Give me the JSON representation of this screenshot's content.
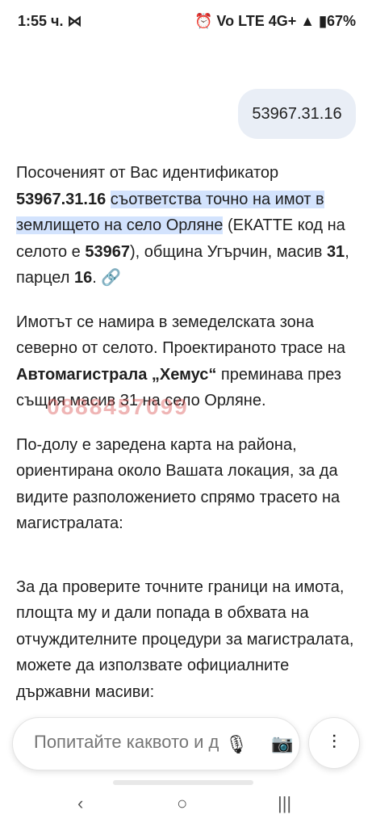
{
  "status": {
    "time": "1:55 ч. ⋈",
    "right": "⏰ Vo LTE 4G+ ▲ ▮67%"
  },
  "user_message": "53967.31.16",
  "p1": {
    "a": "Посоченият от Вас идентификатор ",
    "b": "53967.31.16",
    "c": "съответства точно на имот в землището на село Орляне",
    "d": " (ЕКАТТЕ код на селото е ",
    "e": "53967",
    "f": "), община Угърчин, масив ",
    "g": "31",
    "h": ", парцел ",
    "i": "16",
    "j": ". 🔗"
  },
  "p2": {
    "a": "Имотът се намира в земеделската зона северно от селото. Проектираното трасе на ",
    "b": "Автомагистрала „Хемус“",
    "c": " преминава през същия масив 31 на село Орляне."
  },
  "watermark": "0888457099",
  "p3": "По-долу е заредена карта на района, ориентирана около Вашата локация, за да видите разположението спрямо трасето на магистралата:",
  "p4": "За да проверите точните граници на имота, площта му и дали попада в обхвата на отчуждителните процедури за магистралата, можете да използвате официалните държавни масиви:",
  "input": {
    "placeholder": "Попитайте каквото и да е"
  },
  "icons": {
    "mic": "🎙",
    "camera": "📷",
    "live": "⫶"
  },
  "nav": {
    "back": "‹",
    "home": "○",
    "recents": "|||"
  }
}
